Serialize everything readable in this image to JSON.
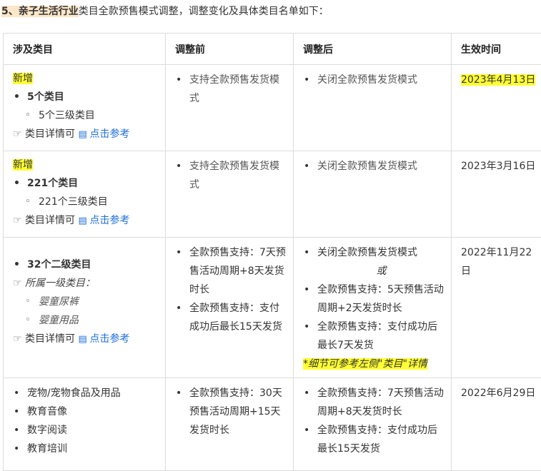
{
  "heading": {
    "highlight": "5、亲子生活行业",
    "rest": "类目全款预售模式调整，调整变化及具体类目名单如下："
  },
  "table": {
    "headers": [
      "涉及类目",
      "调整前",
      "调整后",
      "生效时间"
    ],
    "row1": {
      "tag": "新增",
      "count": "5个类目",
      "sub": "5个三级类目",
      "detail": "类目详情可",
      "link": "点击参考",
      "before": "支持全款预售发货模式",
      "after": "关闭全款预售发货模式",
      "date": "2023年4月13日"
    },
    "row2": {
      "tag": "新增",
      "count": "221个类目",
      "sub": "221个三级类目",
      "detail": "类目详情可",
      "link": "点击参考",
      "before": "支持全款预售发货模式",
      "after": "关闭全款预售发货模式",
      "date": "2023年3月16日"
    },
    "row3": {
      "count": "32个二级类目",
      "parent_label": "所属一级类目：",
      "parents": [
        "婴童尿裤",
        "婴童用品"
      ],
      "detail": "类目详情可",
      "link": "点击参考",
      "before": [
        "全款预售支持：7天预售活动周期+8天发货时长",
        "全款预售支持：支付成功后最长15天发货"
      ],
      "after_first": "关闭全款预售发货模式",
      "or": "或",
      "after": [
        "全款预售支持：5天预售活动周期+2天发货时长",
        "全款预售支持：支付成功后最长7天发货"
      ],
      "note": "*细节可参考左侧\"类目\"详情",
      "date": "2022年11月22日"
    },
    "row4": {
      "categories": [
        "宠物/宠物食品及用品",
        "教育音像",
        "数字阅读",
        "教育培训"
      ],
      "before": [
        "全款预售支持：30天预售活动周期+15天发货时长"
      ],
      "after": [
        "全款预售支持：7天预售活动周期+8天发货时长",
        "全款预售支持：支付成功后最长15天发货"
      ],
      "date": "2022年6月29日"
    }
  },
  "icons": {
    "hand": "hand-pointing-icon",
    "doc": "document-icon"
  },
  "colors": {
    "highlight_yellow": "#ffff33",
    "heading_highlight": "#fde7c8",
    "link_blue": "#1e6fd9"
  }
}
